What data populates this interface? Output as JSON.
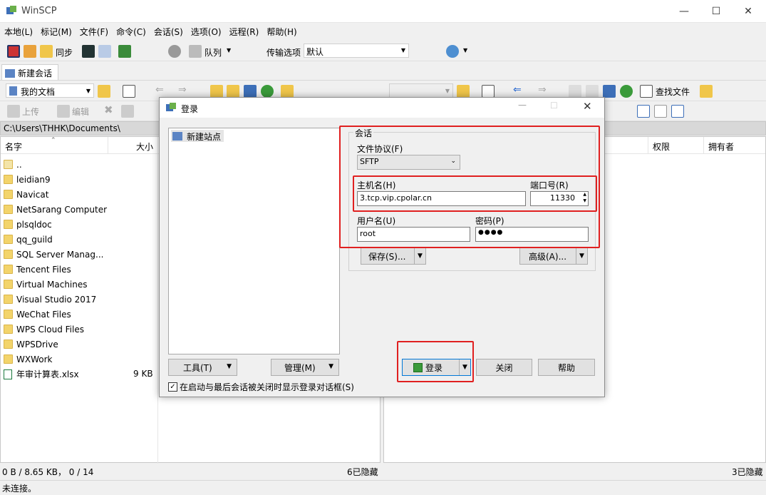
{
  "app": {
    "title": "WinSCP"
  },
  "menu": [
    "本地(L)",
    "标记(M)",
    "文件(F)",
    "命令(C)",
    "会话(S)",
    "选项(O)",
    "远程(R)",
    "帮助(H)"
  ],
  "toolbar": {
    "sync_label": "同步",
    "queue_label": "队列",
    "transfer_label": "传输选项",
    "transfer_value": "默认"
  },
  "session_tab": {
    "label": "新建会话"
  },
  "local_toolbar": {
    "location": "我的文档",
    "upload": "上传",
    "edit": "编辑"
  },
  "remote_toolbar": {
    "find_files": "查找文件"
  },
  "local": {
    "path": "C:\\Users\\THHK\\Documents\\",
    "columns": {
      "name": "名字",
      "size": "大小"
    },
    "files": [
      {
        "name": "..",
        "size": "",
        "kind": "up"
      },
      {
        "name": "leidian9",
        "size": "",
        "kind": "folder"
      },
      {
        "name": "Navicat",
        "size": "",
        "kind": "folder"
      },
      {
        "name": "NetSarang Computer",
        "size": "",
        "kind": "folder"
      },
      {
        "name": "plsqldoc",
        "size": "",
        "kind": "folder"
      },
      {
        "name": "qq_guild",
        "size": "",
        "kind": "folder"
      },
      {
        "name": "SQL Server Manag...",
        "size": "",
        "kind": "folder"
      },
      {
        "name": "Tencent Files",
        "size": "",
        "kind": "folder"
      },
      {
        "name": "Virtual Machines",
        "size": "",
        "kind": "folder"
      },
      {
        "name": "Visual Studio 2017",
        "size": "",
        "kind": "folder"
      },
      {
        "name": "WeChat Files",
        "size": "",
        "kind": "folder"
      },
      {
        "name": "WPS Cloud Files",
        "size": "",
        "kind": "folder"
      },
      {
        "name": "WPSDrive",
        "size": "",
        "kind": "folder"
      },
      {
        "name": "WXWork",
        "size": "",
        "kind": "folder"
      },
      {
        "name": "年审计算表.xlsx",
        "size": "9 KB",
        "kind": "xlsx"
      }
    ]
  },
  "remote": {
    "columns": {
      "perm": "权限",
      "owner": "拥有者"
    }
  },
  "status": {
    "left_info": "0 B / 8.65 KB，  0 / 14",
    "left_hidden": "6已隐藏",
    "right_hidden": "3已隐藏",
    "connection": "未连接。"
  },
  "login": {
    "title": "登录",
    "tree_item": "新建站点",
    "group_label": "会话",
    "protocol_label": "文件协议(F)",
    "protocol_value": "SFTP",
    "host_label": "主机名(H)",
    "host_value": "3.tcp.vip.cpolar.cn",
    "port_label": "端口号(R)",
    "port_value": "11330",
    "user_label": "用户名(U)",
    "user_value": "root",
    "pass_label": "密码(P)",
    "pass_value": "●●●●",
    "save_btn": "保存(S)...",
    "advanced_btn": "高级(A)...",
    "tools_btn": "工具(T)",
    "manage_btn": "管理(M)",
    "login_btn": "登录",
    "close_btn": "关闭",
    "help_btn": "帮助",
    "checkbox_label": "在启动与最后会话被关闭时显示登录对话框(S)"
  },
  "colors": {
    "highlight_red": "#e02020",
    "accent": "#1a7fd4"
  }
}
